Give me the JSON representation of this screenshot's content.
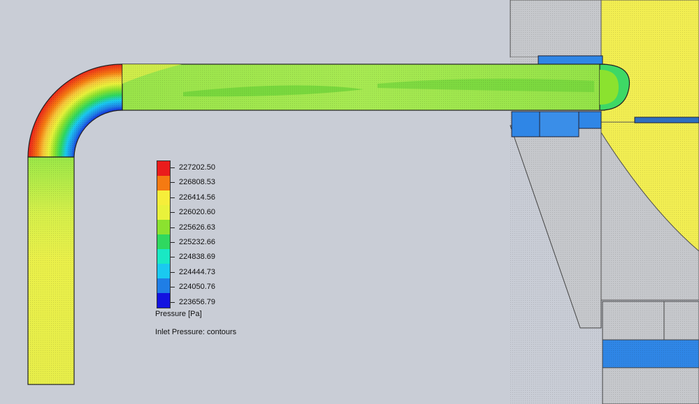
{
  "legend": {
    "values": [
      "227202.50",
      "226808.53",
      "226414.56",
      "226020.60",
      "225626.63",
      "225232.66",
      "224838.69",
      "224444.73",
      "224050.76",
      "223656.79"
    ],
    "colors": [
      "#ea1c1c",
      "#f57a12",
      "#f6ee3a",
      "#e9f23b",
      "#8be22f",
      "#2fd85f",
      "#19e8c4",
      "#1ac9f0",
      "#1f7ee6",
      "#1313e0"
    ],
    "title": "Pressure [Pa]",
    "plot_title": "Inlet Pressure: contours"
  },
  "colors": {
    "background": "#c9cdd6",
    "pipe_green": "#a3e84e",
    "pipe_yellow": "#e8ef4c",
    "housing_gray": "#c4c6ca",
    "housing_blue": "#2d7fe1",
    "housing_yellow": "#f3ee51"
  }
}
